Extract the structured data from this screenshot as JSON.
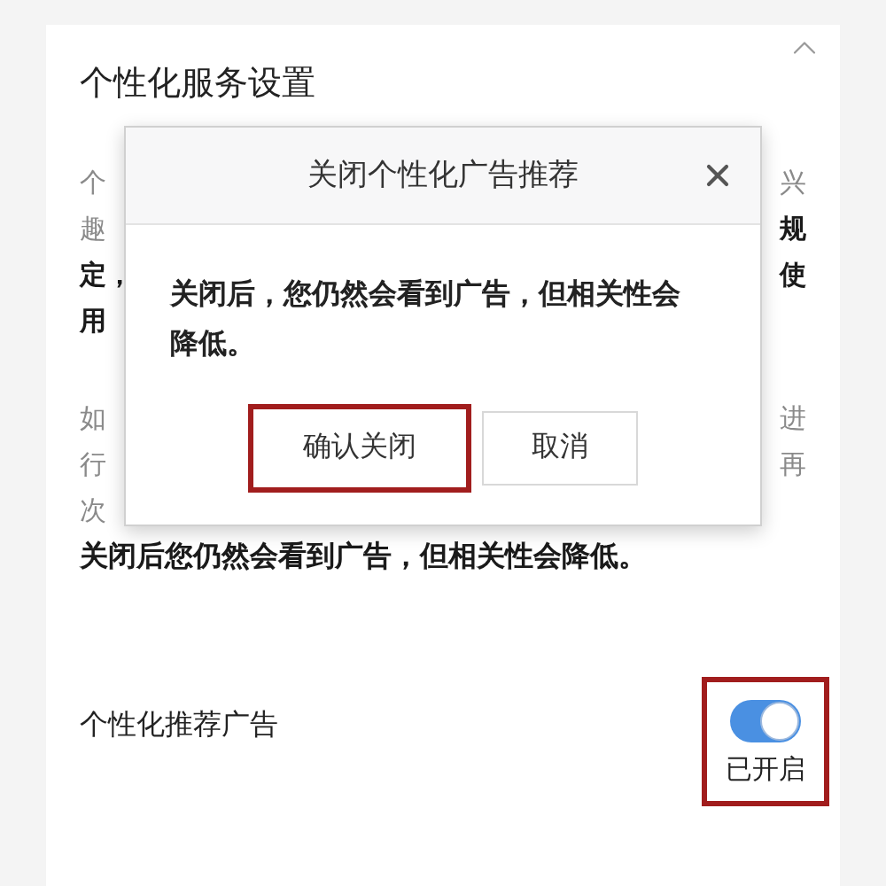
{
  "section": {
    "title": "个性化服务设置",
    "expanded": true
  },
  "background_paragraphs": [
    [
      {
        "left": {
          "text": "个",
          "bold": false
        },
        "right": {
          "text": "兴",
          "bold": false
        }
      },
      {
        "left": {
          "text": "趣",
          "bold": false
        },
        "right": {
          "text": "规",
          "bold": true
        }
      },
      {
        "left": {
          "text": "定，",
          "bold": true
        },
        "right": {
          "text": "使",
          "bold": true
        }
      },
      {
        "left": {
          "text": "用",
          "bold": true
        }
      }
    ],
    [
      {
        "left": {
          "text": "如",
          "bold": false
        },
        "right": {
          "text": "进",
          "bold": false
        }
      },
      {
        "left": {
          "text": "行",
          "bold": false
        },
        "right": {
          "text": "再",
          "bold": false
        }
      },
      {
        "left": {
          "text": "次",
          "bold": false
        }
      }
    ]
  ],
  "notice": "关闭后您仍然会看到广告，但相关性会降低。",
  "setting": {
    "label": "个性化推荐广告",
    "on": true,
    "status": "已开启",
    "highlighted": true
  },
  "dialog": {
    "title": "关闭个性化广告推荐",
    "message": "关闭后，您仍然会看到广告，但相关性会降低。",
    "buttons": [
      {
        "label": "确认关闭",
        "highlighted": true
      },
      {
        "label": "取消",
        "highlighted": false
      }
    ]
  }
}
